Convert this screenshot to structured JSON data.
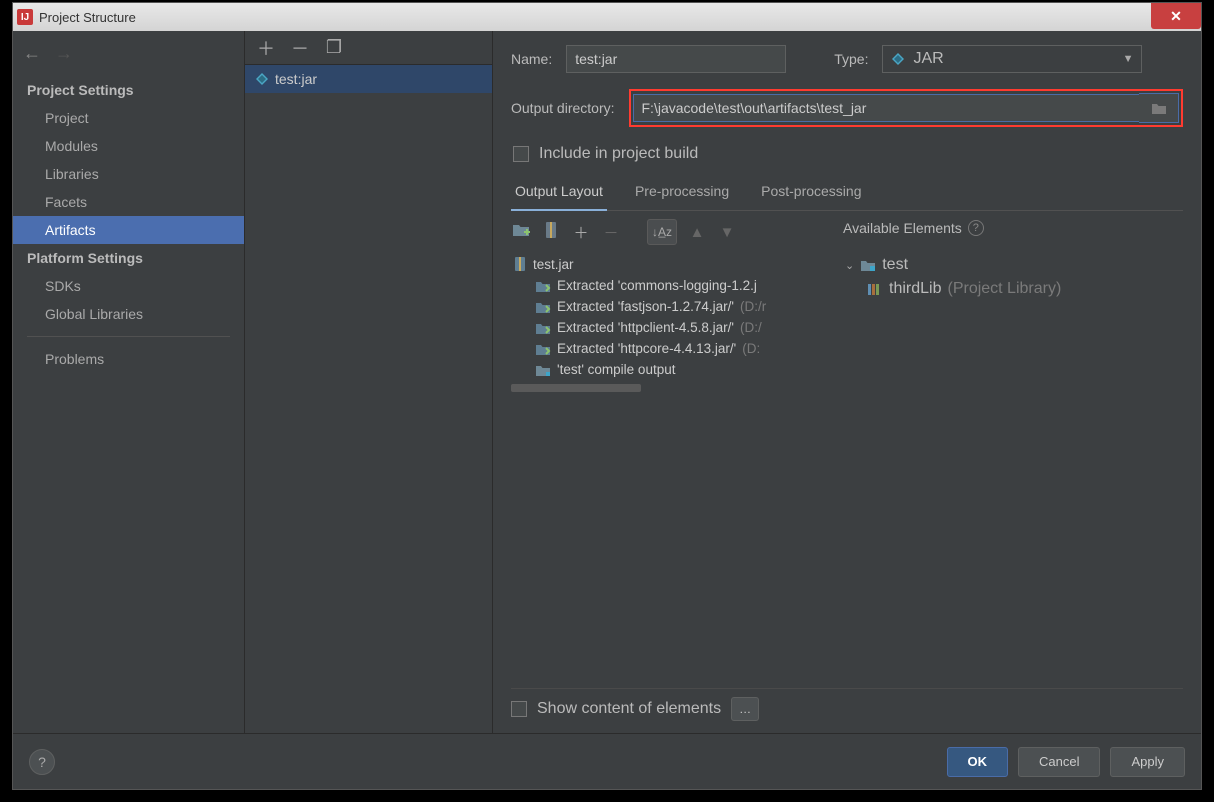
{
  "window": {
    "title": "Project Structure"
  },
  "sidebar": {
    "heading_project": "Project Settings",
    "items_project": [
      "Project",
      "Modules",
      "Libraries",
      "Facets",
      "Artifacts"
    ],
    "heading_platform": "Platform Settings",
    "items_platform": [
      "SDKs",
      "Global Libraries"
    ],
    "problems": "Problems"
  },
  "middle": {
    "artifact_name": "test:jar"
  },
  "right": {
    "name_label": "Name:",
    "name_value": "test:jar",
    "type_label": "Type:",
    "type_value": "JAR",
    "outdir_label": "Output directory:",
    "outdir_value": "F:\\javacode\\test\\out\\artifacts\\test_jar",
    "include_label": "Include in project build",
    "tabs": [
      "Output Layout",
      "Pre-processing",
      "Post-processing"
    ],
    "avail_header": "Available Elements",
    "tree": {
      "root": "test.jar",
      "items": [
        "Extracted 'commons-logging-1.2.j",
        "Extracted 'fastjson-1.2.74.jar/'",
        "Extracted 'httpclient-4.5.8.jar/'",
        "Extracted 'httpcore-4.4.13.jar/'",
        "'test' compile output"
      ],
      "item_dims": [
        "",
        " (D:/r",
        " (D:/",
        " (D:",
        ""
      ]
    },
    "avail": {
      "module": "test",
      "lib": "thirdLib",
      "lib_suffix": "(Project Library)"
    },
    "show_content": "Show content of elements"
  },
  "footer": {
    "ok": "OK",
    "cancel": "Cancel",
    "apply": "Apply"
  }
}
